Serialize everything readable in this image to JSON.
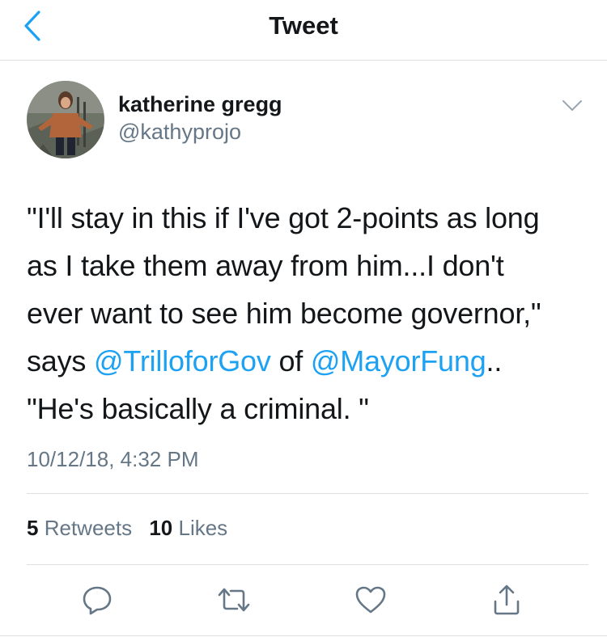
{
  "header": {
    "title": "Tweet",
    "back_icon": "chevron-left-icon"
  },
  "author": {
    "name": "katherine gregg",
    "handle": "@kathyprojo",
    "menu_icon": "chevron-down-icon"
  },
  "tweet": {
    "line1": "\"I'll stay in this if I've got 2-points as long",
    "line2": "as I take them away from him...I don't",
    "line3": "ever want to see him become governor,\"",
    "line4_prefix": "says ",
    "mention1": "@TrilloforGov",
    "line4_mid": " of ",
    "mention2": "@MayorFung",
    "line4_suffix": "..",
    "line5": "\"He's basically a criminal. \""
  },
  "timestamp": "10/12/18, 4:32 PM",
  "stats": {
    "retweets_count": "5",
    "retweets_label": "Retweets",
    "likes_count": "10",
    "likes_label": "Likes"
  },
  "actions": {
    "reply_icon": "reply-icon",
    "retweet_icon": "retweet-icon",
    "like_icon": "heart-icon",
    "share_icon": "share-icon"
  },
  "colors": {
    "link": "#1da1f2",
    "secondary_text": "#657786",
    "primary_text": "#14171a",
    "divider": "#dcdfe2"
  }
}
